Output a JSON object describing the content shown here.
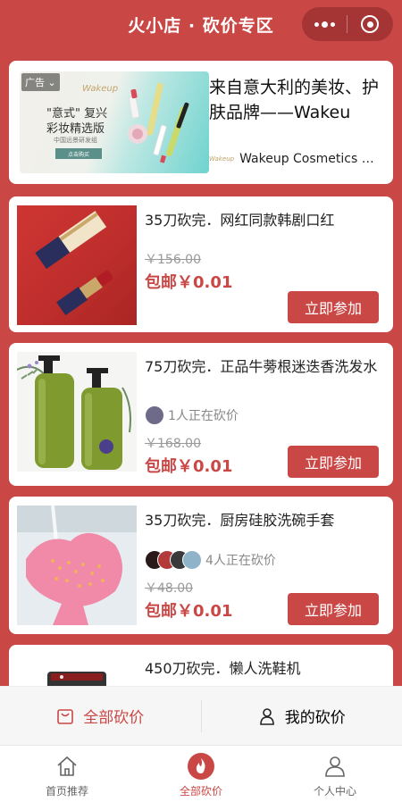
{
  "header": {
    "title": "火小店 · 砍价专区"
  },
  "ad": {
    "tag": "广告",
    "image_logo": "Wakeup",
    "image_line1": "\"意式\" 复兴",
    "image_line2": "彩妆精选版",
    "image_line3": "中国远景研发组",
    "image_button": "点击购买",
    "title": "来自意大利的美妆、护肤品牌——Wakeu",
    "brand_logo": "Wakeup",
    "brand_name": "Wakeup Cosmetics Mi..."
  },
  "products": [
    {
      "title": "35刀砍完．网红同款韩剧口红",
      "bargainers": "",
      "original_price": "￥156.00",
      "price": "包邮￥0.01",
      "button": "立即参加"
    },
    {
      "title": "75刀砍完．正品牛蒡根迷迭香洗发水",
      "bargainers": "1人正在砍价",
      "original_price": "￥168.00",
      "price": "包邮￥0.01",
      "button": "立即参加"
    },
    {
      "title": "35刀砍完．厨房硅胶洗碗手套",
      "bargainers": "4人正在砍价",
      "original_price": "￥48.00",
      "price": "包邮￥0.01",
      "button": "立即参加"
    },
    {
      "title": "450刀砍完．懒人洗鞋机"
    }
  ],
  "sub_tabs": {
    "all": "全部砍价",
    "mine": "我的砍价"
  },
  "tabbar": {
    "home": "首页推荐",
    "all": "全部砍价",
    "me": "个人中心"
  },
  "colors": {
    "brand": "#c94846",
    "price": "#c94846",
    "muted": "#999999"
  }
}
